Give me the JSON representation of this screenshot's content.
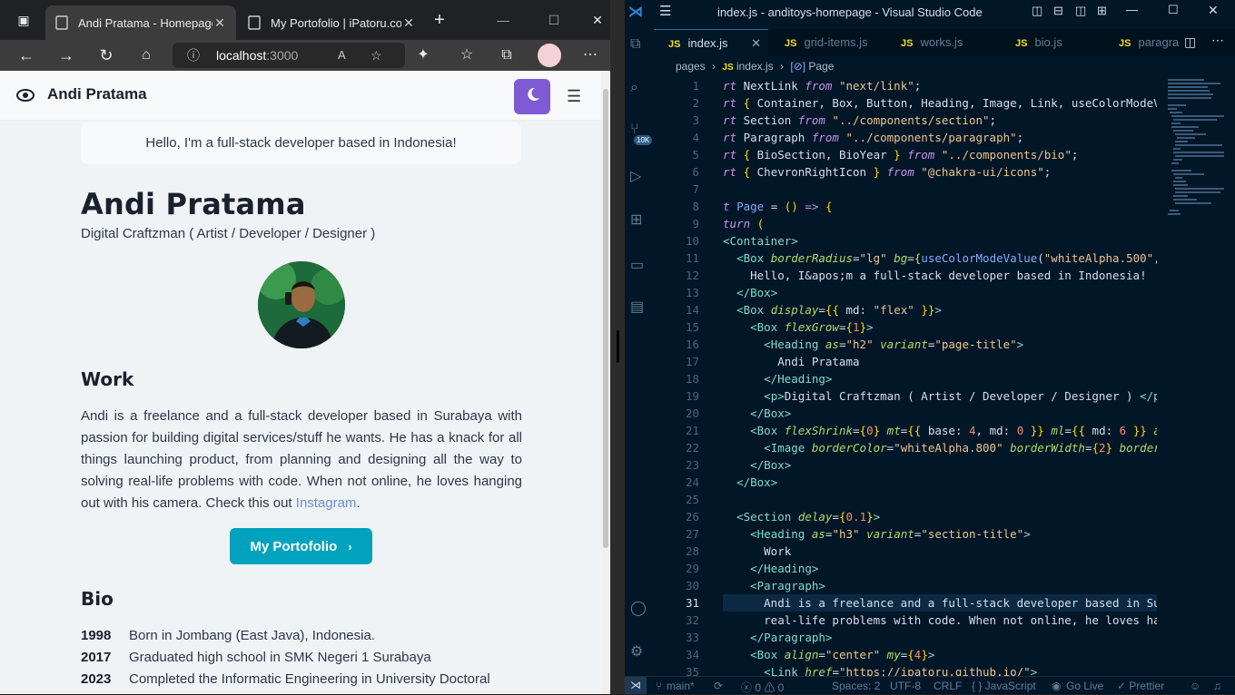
{
  "browser": {
    "tabs": [
      {
        "title": "Andi Pratama - Homepage"
      },
      {
        "title": "My Portofolio | iPatoru.com"
      }
    ],
    "url": {
      "host": "localhost",
      "port": ":3000"
    }
  },
  "site": {
    "logo_text": "Andi Pratama",
    "hello": "Hello, I'm a full-stack developer based in Indonesia!",
    "name": "Andi Pratama",
    "role": "Digital Craftzman ( Artist / Developer / Designer )",
    "work_title": "Work",
    "work_text": "Andi is a freelance and a full-stack developer based in Surabaya with passion for building digital services/stuff he wants. He has a knack for all things launching product, from planning and designing all the way to solving real-life problems with code. When not online, he loves hanging out with his camera. Check this out ",
    "work_link": "Instagram",
    "work_end": ".",
    "portfolio_button": "My Portofolio",
    "bio_title": "Bio",
    "bio": [
      {
        "year": "1998",
        "text": "Born in Jombang (East Java), Indonesia."
      },
      {
        "year": "2017",
        "text": "Graduated high school in SMK Negeri 1 Surabaya"
      },
      {
        "year": "2023",
        "text": "Completed the Informatic Engineering in University Doctoral"
      }
    ]
  },
  "vscode": {
    "title": "index.js - anditoys-homepage - Visual Studio Code",
    "badge": "10K",
    "tabs": [
      "index.js",
      "grid-items.js",
      "works.js",
      "bio.js",
      "paragra"
    ],
    "breadcrumb": {
      "folder": "pages",
      "file": "index.js",
      "symbol": "Page"
    },
    "line_numbers": [
      "1",
      "2",
      "3",
      "4",
      "5",
      "6",
      "7",
      "8",
      "9",
      "10",
      "11",
      "12",
      "13",
      "14",
      "15",
      "16",
      "17",
      "18",
      "19",
      "20",
      "21",
      "22",
      "23",
      "24",
      "25",
      "26",
      "27",
      "28",
      "29",
      "30",
      "31",
      "32",
      "33",
      "34",
      "35"
    ],
    "status": {
      "branch": "main*",
      "sync": "⟳",
      "errors": "ⓧ 0 ⚠ 0",
      "spaces": "Spaces: 2",
      "encoding": "UTF-8",
      "eol": "CRLF",
      "lang": "{ } JavaScript",
      "golive": "Go Live",
      "prettier": "✓ Prettier"
    }
  },
  "colors": {
    "accent_purple": "#805ad5",
    "portfolio_teal": "#00a2bd",
    "link_blue": "#6b8fd1",
    "vscode_bg": "#011627"
  }
}
